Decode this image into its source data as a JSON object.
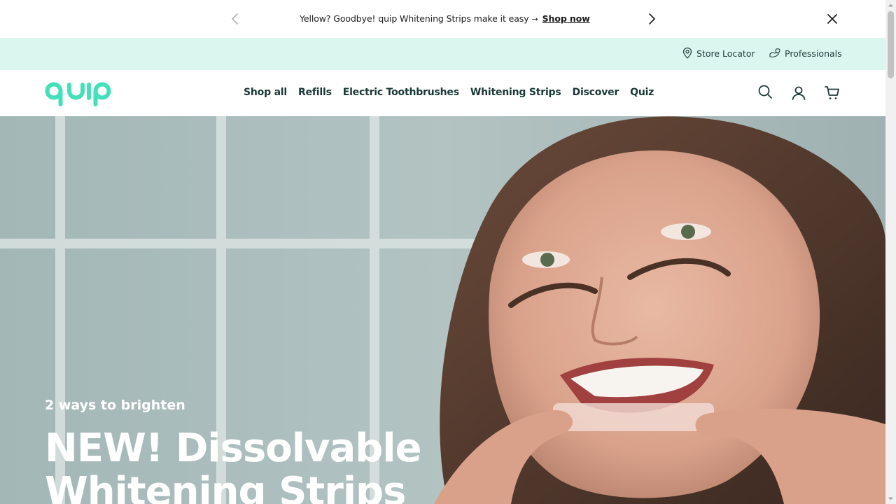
{
  "announcement": {
    "message": "Yellow? Goodbye! quip Whitening Strips make it easy",
    "arrow": "→",
    "cta": "Shop now",
    "prev_icon": "chevron-left-icon",
    "next_icon": "chevron-right-icon",
    "close_icon": "close-icon"
  },
  "utility": {
    "store_locator": "Store Locator",
    "professionals": "Professionals"
  },
  "header": {
    "logo_text": "quip",
    "nav": [
      "Shop all",
      "Refills",
      "Electric Toothbrushes",
      "Whitening Strips",
      "Discover",
      "Quiz"
    ],
    "icons": [
      "search-icon",
      "account-icon",
      "cart-icon"
    ]
  },
  "hero": {
    "eyebrow": "2 ways to brighten",
    "title": "NEW! Dissolvable Whitening Strips"
  },
  "colors": {
    "brand_mint": "#43e0b9",
    "utility_bg": "#d9f7ee",
    "nav_text": "#173836"
  }
}
